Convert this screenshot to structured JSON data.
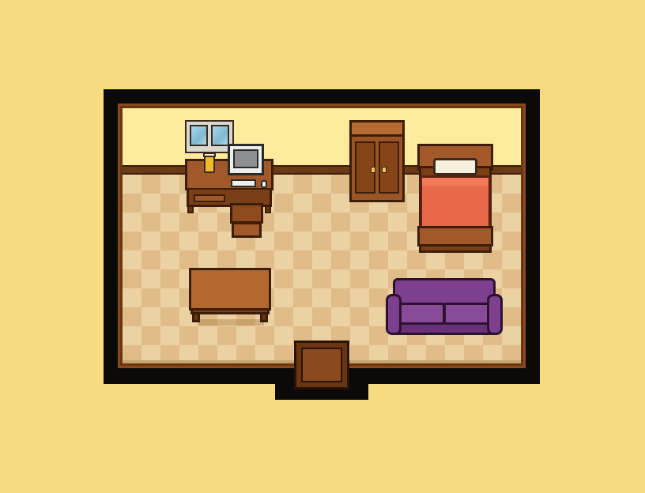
{
  "scene": {
    "name": "",
    "colors": {
      "background": "#f6dc7e",
      "frame": "#0c0a08",
      "wall": "#fbeb9c",
      "floor_light": "#ecd2a2",
      "floor_dark": "#e0bd88",
      "wood": "#a1592a",
      "blanket": "#e8684a",
      "sofa": "#7e3f8f"
    },
    "objects": [
      "window",
      "desk",
      "lamp",
      "computer-monitor",
      "keyboard",
      "mouse",
      "chair",
      "wardrobe",
      "bed",
      "coffee-table",
      "sofa",
      "door"
    ]
  }
}
